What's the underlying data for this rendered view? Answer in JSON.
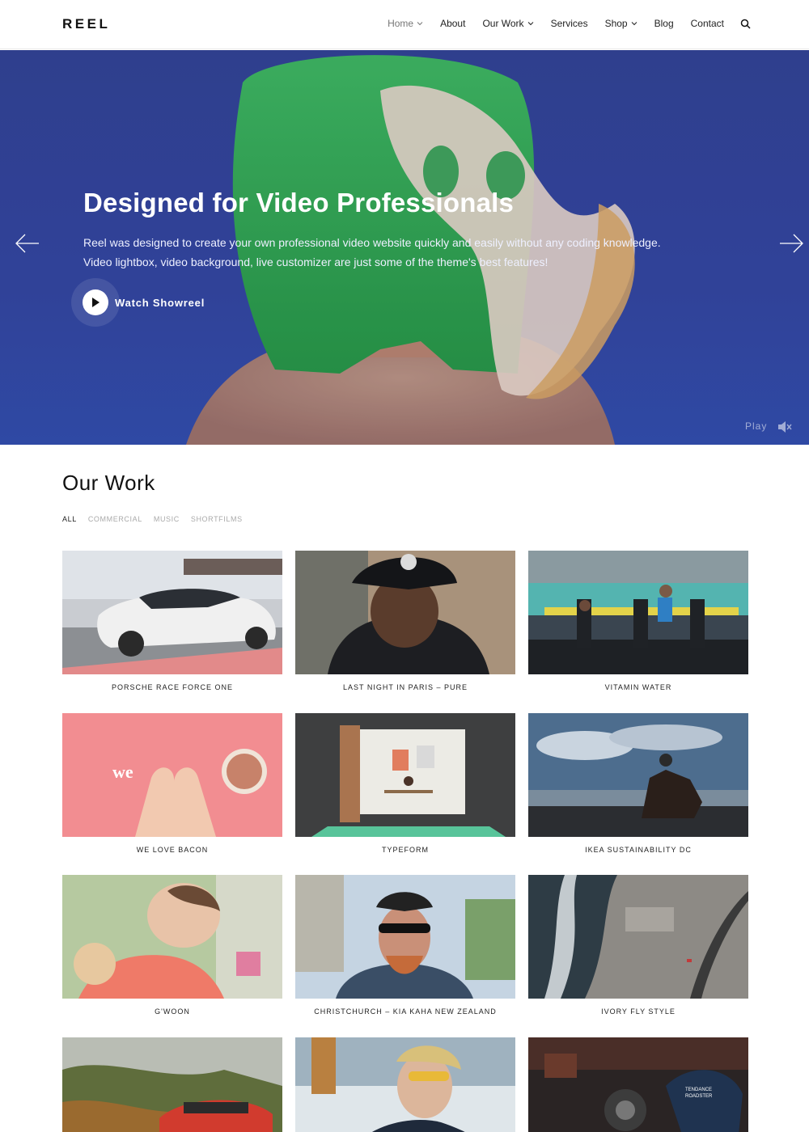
{
  "header": {
    "logo": "REEL",
    "nav": [
      {
        "label": "Home",
        "dropdown": true,
        "active": true
      },
      {
        "label": "About",
        "dropdown": false
      },
      {
        "label": "Our Work",
        "dropdown": true
      },
      {
        "label": "Services",
        "dropdown": false
      },
      {
        "label": "Shop",
        "dropdown": true
      },
      {
        "label": "Blog",
        "dropdown": false
      },
      {
        "label": "Contact",
        "dropdown": false
      }
    ]
  },
  "hero": {
    "title": "Designed for Video Professionals",
    "text_line1": "Reel was designed to create your own professional video website quickly and easily without any coding knowledge.",
    "text_line2": "Video lightbox, video background, live customizer are just some of the theme's best features!",
    "cta": "Watch Showreel",
    "play_label": "Play"
  },
  "work": {
    "title": "Our Work",
    "filters": [
      "ALL",
      "COMMERCIAL",
      "MUSIC",
      "SHORTFILMS"
    ],
    "items": [
      {
        "title": "PORSCHE RACE FORCE ONE"
      },
      {
        "title": "LAST NIGHT IN PARIS – PURE"
      },
      {
        "title": "VITAMIN WATER"
      },
      {
        "title": "WE LOVE BACON",
        "overlay": "we"
      },
      {
        "title": "TYPEFORM"
      },
      {
        "title": "IKEA SUSTAINABILITY DC"
      },
      {
        "title": "G'WOON"
      },
      {
        "title": "CHRISTCHURCH – KIA KAHA NEW ZEALAND"
      },
      {
        "title": "IVORY FLY STYLE"
      },
      {
        "title": ""
      },
      {
        "title": ""
      },
      {
        "title": "",
        "overlay_line1": "TENDANCE",
        "overlay_line2": "ROADSTER"
      }
    ]
  },
  "colors": {
    "hero_blue": "#30439a",
    "hair_green": "#2fa84a",
    "text_dark": "#111111",
    "filter_inactive": "#aaaaaa"
  }
}
